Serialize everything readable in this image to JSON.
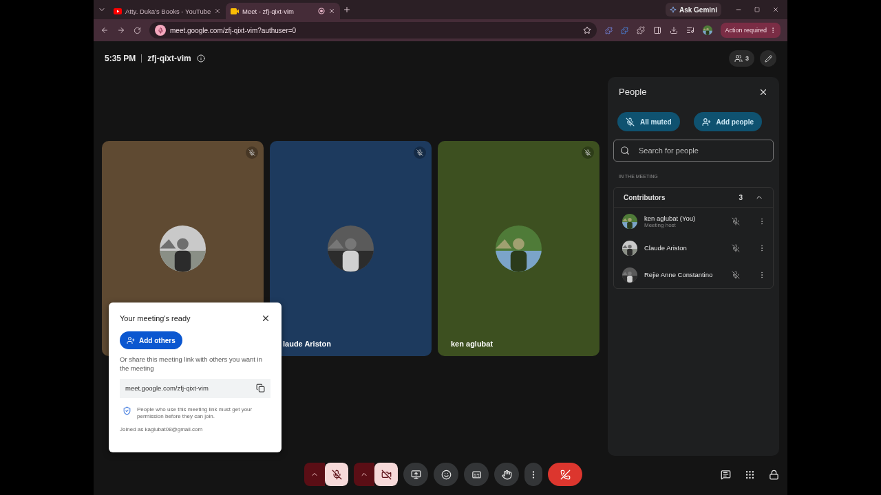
{
  "browser": {
    "tabs": [
      {
        "title": "Atty. Duka's Books - YouTube",
        "selected": false,
        "kind": "youtube"
      },
      {
        "title": "Meet - zfj-qixt-vim",
        "selected": true,
        "kind": "meet"
      }
    ],
    "ask_button": "Ask Gemini",
    "url": "meet.google.com/zfj-qixt-vim?authuser=0",
    "action_button": "Action required"
  },
  "meeting": {
    "time": "5:35 PM",
    "code": "zfj-qixt-vim",
    "participant_count": "3"
  },
  "tiles": [
    {
      "color": "#5f4a32",
      "muted": true
    },
    {
      "name": "laude Ariston",
      "color": "#1d3a5e",
      "muted": true
    },
    {
      "name": "ken aglubat",
      "color": "#3d5020",
      "muted": true
    }
  ],
  "people_panel": {
    "title": "People",
    "all_muted_button": "All muted",
    "add_people_button": "Add people",
    "search": {
      "placeholder": "Search for people"
    },
    "section_label": "IN THE MEETING",
    "group": {
      "title": "Contributors",
      "count": "3",
      "expanded": true
    },
    "people": [
      {
        "name": "ken aglubat (You)",
        "role": "Meeting host"
      },
      {
        "name": "Claude Ariston"
      },
      {
        "name": "Rejie Anne Constantino"
      }
    ]
  },
  "dialog": {
    "title": "Your meeting's ready",
    "add_button": "Add others",
    "text": "Or share this meeting link with others you want in the meeting",
    "link": "meet.google.com/zfj-qixt-vim",
    "notice": "People who use this meeting link must get your permission before they can join.",
    "joined": "Joined as kaglubat08@gmail.com"
  },
  "controls": [
    {
      "kind": "mic",
      "on": false
    },
    {
      "kind": "camera",
      "on": false
    },
    {
      "kind": "present"
    },
    {
      "kind": "emoji"
    },
    {
      "kind": "captions"
    },
    {
      "kind": "hand"
    },
    {
      "kind": "more"
    },
    {
      "kind": "leave"
    }
  ]
}
